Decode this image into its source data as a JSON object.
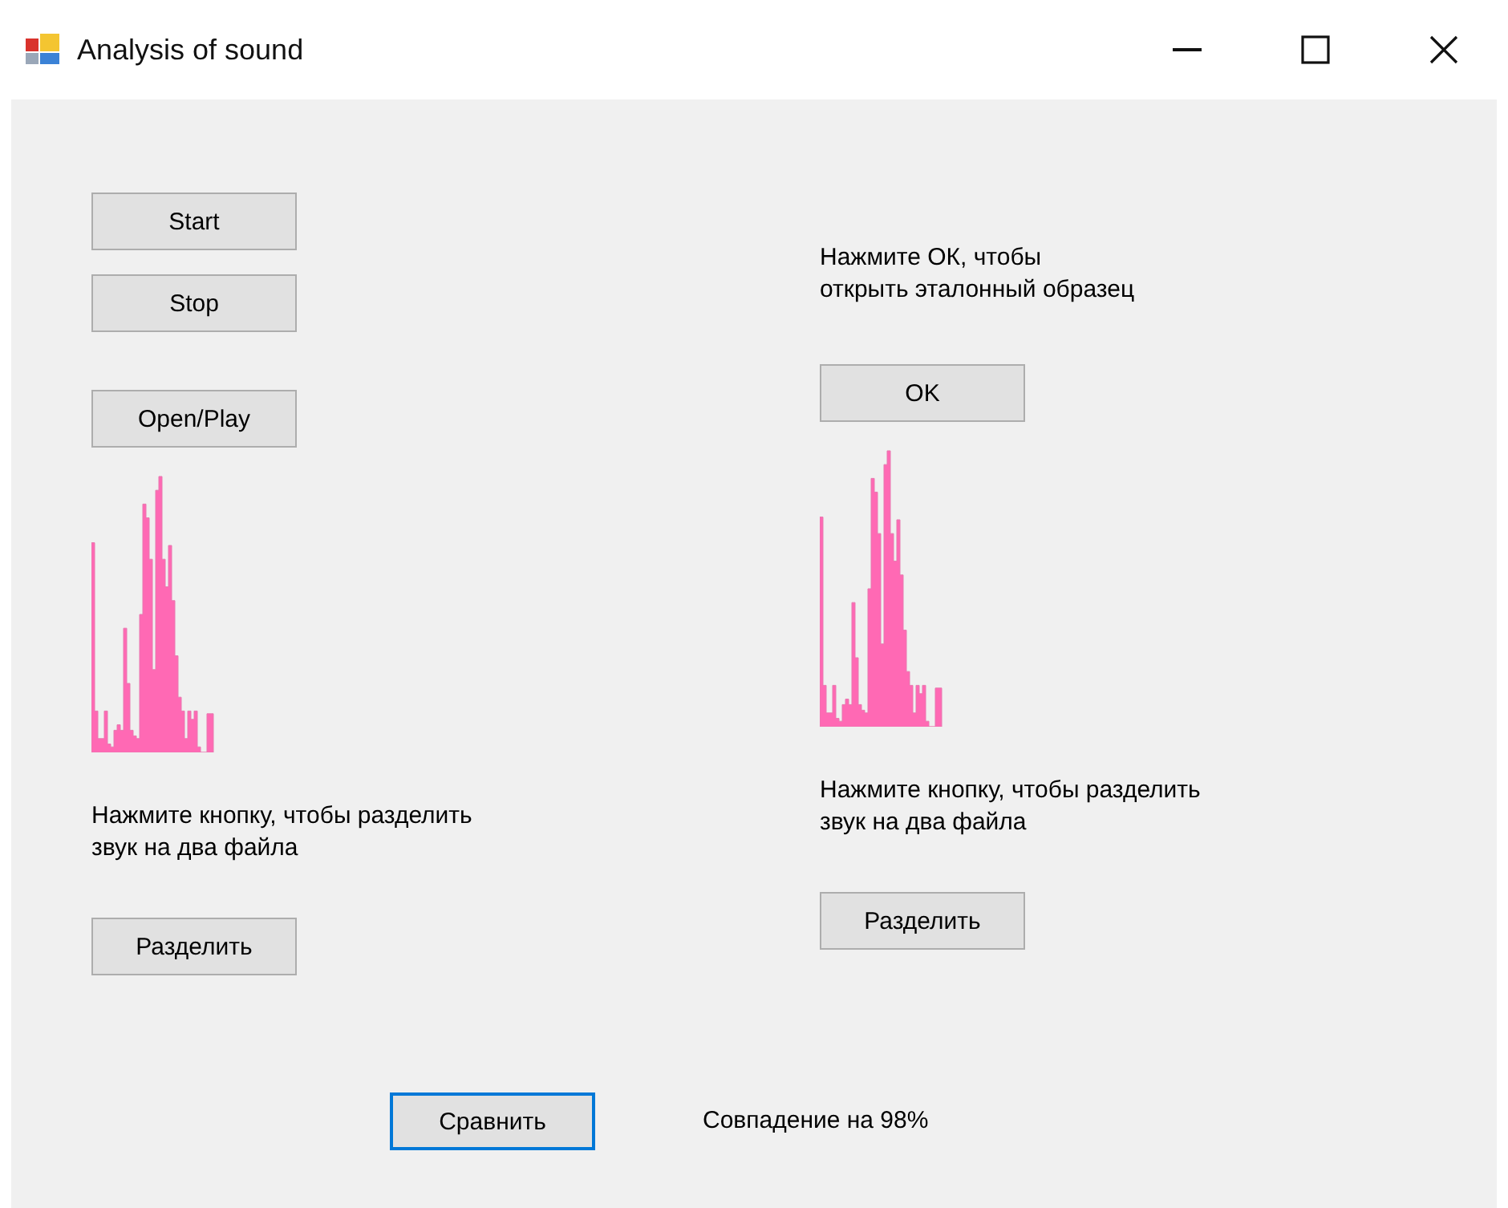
{
  "window": {
    "title": "Analysis of sound"
  },
  "left_panel": {
    "buttons": [
      {
        "label": "Start"
      },
      {
        "label": "Stop"
      },
      {
        "label": "Open/Play"
      }
    ],
    "hint": "Нажмите кнопку, чтобы разделить\nзвук на два файла",
    "split_button": "Разделить"
  },
  "right_panel": {
    "prompt": "Нажмите ОК, чтобы\nоткрыть эталонный образец",
    "ok_button": "OK",
    "hint": "Нажмите кнопку, чтобы разделить\nзвук на два файла",
    "split_button": "Разделить"
  },
  "footer": {
    "compare_button": {
      "label": "Сравнить",
      "focused": true
    },
    "result": "Совпадение на 98%"
  }
}
